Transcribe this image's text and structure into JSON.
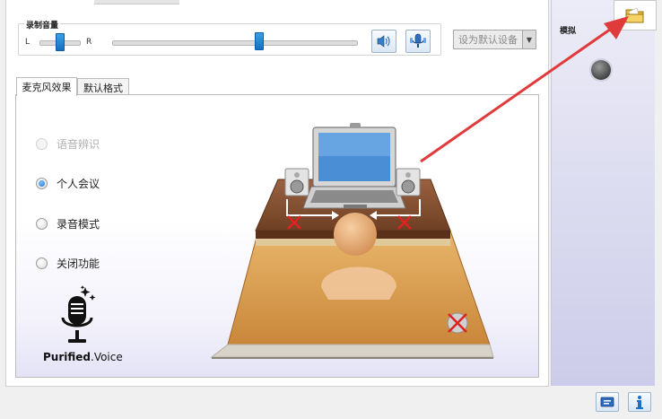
{
  "volume": {
    "title": "录制音量",
    "balance_left": "L",
    "balance_right": "R",
    "balance_level": 0.5,
    "volume_level": 0.6
  },
  "set_default": {
    "label": "设为默认设备"
  },
  "tabs": [
    {
      "label": "麦克风效果",
      "active": true
    },
    {
      "label": "默认格式",
      "active": false
    }
  ],
  "effects": {
    "options": [
      {
        "label": "语音辨识",
        "selected": false,
        "disabled": true
      },
      {
        "label": "个人会议",
        "selected": true,
        "disabled": false
      },
      {
        "label": "录音模式",
        "selected": false,
        "disabled": false
      },
      {
        "label": "关闭功能",
        "selected": false,
        "disabled": false
      }
    ]
  },
  "brand": {
    "part1": "Purified",
    "part2": ".Voice"
  },
  "right_panel": {
    "analog_label": "模拟"
  },
  "colors": {
    "accent": "#1e6fc7",
    "annotation_arrow": "#e03a3a",
    "desk": "#7a4a2a",
    "floor": "#d89a45"
  },
  "icons": [
    "speaker-icon",
    "microphone-array-icon",
    "folder-icon",
    "chevron-down-icon",
    "microphone-icon",
    "info-icon",
    "device-icon"
  ]
}
